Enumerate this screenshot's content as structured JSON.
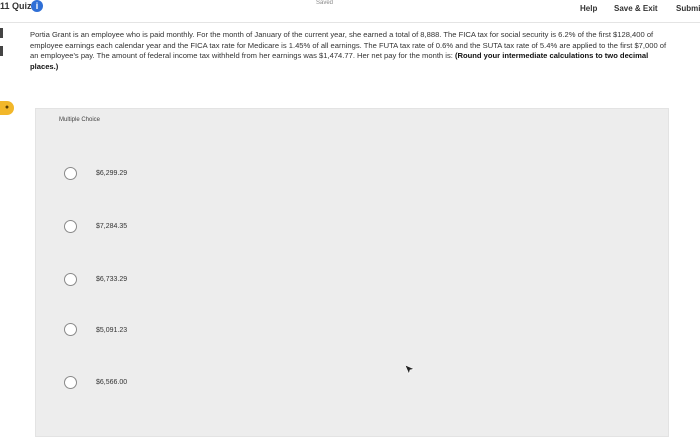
{
  "header": {
    "quiz_title": "11 Quiz",
    "status": "Saved",
    "help_label": "Help",
    "save_exit_label": "Save & Exit",
    "submit_label": "Submi"
  },
  "question": {
    "text": "Portia Grant is an employee who is paid monthly. For the month of January of the current year, she earned a total of 8,888. The FICA tax for social security is 6.2% of the first $128,400 of employee earnings each calendar year and the FICA tax rate for Medicare is 1.45% of all earnings. The FUTA tax rate of 0.6% and the SUTA tax rate of 5.4% are applied to the first $7,000 of an employee's pay. The amount of federal income tax withheld from her earnings was $1,474.77. Her net pay for the month is: ",
    "instruction": "(Round your intermediate calculations to two decimal places.)"
  },
  "answer_section": {
    "label": "Multiple Choice",
    "choices": [
      {
        "label": "$6,299.29"
      },
      {
        "label": "$7,284.35"
      },
      {
        "label": "$6,733.29"
      },
      {
        "label": "$5,091.23"
      },
      {
        "label": "$6,566.00"
      }
    ]
  },
  "colors": {
    "info_icon": "#2f6fd6",
    "edge_badge": "#f2b72a",
    "panel_bg": "#ededed"
  }
}
